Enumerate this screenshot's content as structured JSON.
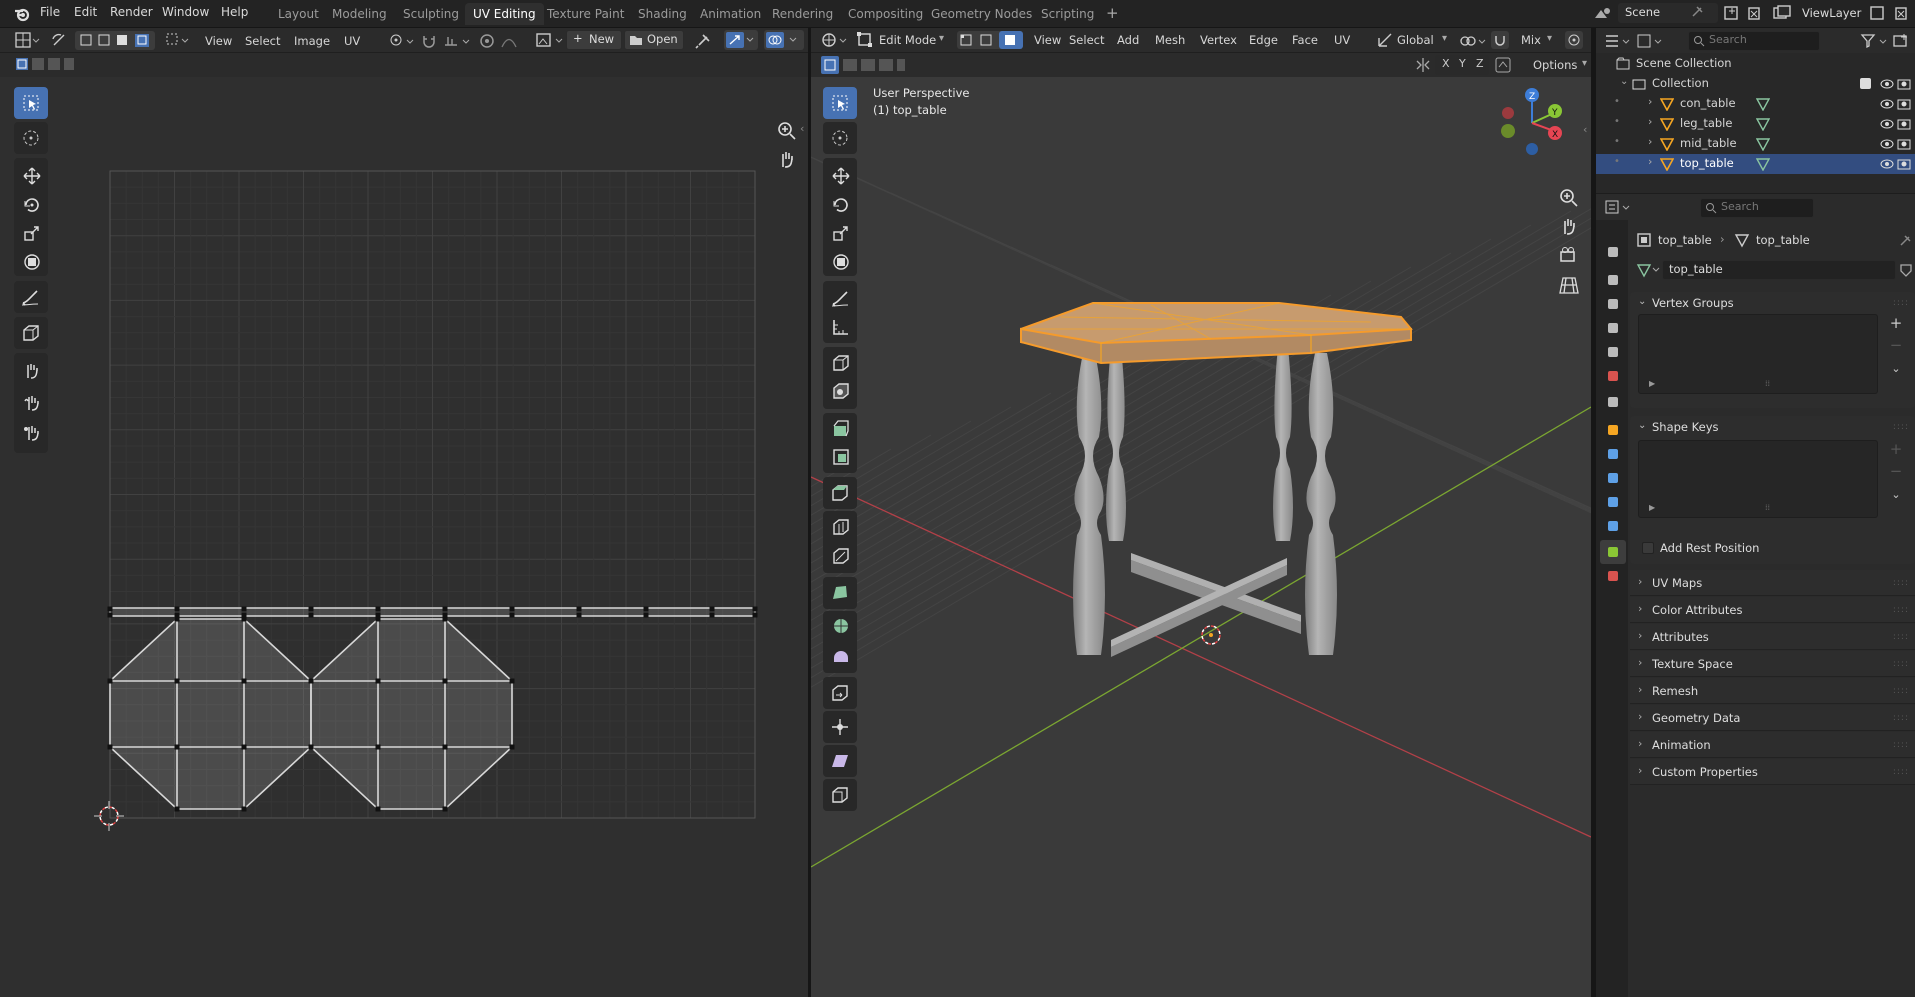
{
  "menu": {
    "file": "File",
    "edit": "Edit",
    "render": "Render",
    "window": "Window",
    "help": "Help"
  },
  "workspaces": [
    "Layout",
    "Modeling",
    "Sculpting",
    "UV Editing",
    "Texture Paint",
    "Shading",
    "Animation",
    "Rendering",
    "Compositing",
    "Geometry Nodes",
    "Scripting"
  ],
  "active_workspace": "UV Editing",
  "scene": {
    "label": "Scene",
    "view_layer": "ViewLayer"
  },
  "uv_header": {
    "view": "View",
    "select": "Select",
    "image": "Image",
    "uv": "UV",
    "new": "New",
    "open": "Open"
  },
  "vp_header": {
    "mode": "Edit Mode",
    "view": "View",
    "select": "Select",
    "add": "Add",
    "mesh": "Mesh",
    "vertex": "Vertex",
    "edge": "Edge",
    "face": "Face",
    "uv": "UV",
    "orientation": "Global",
    "proportional": "Mix",
    "options": "Options",
    "axis_x": "X",
    "axis_y": "Y",
    "axis_z": "Z"
  },
  "viewport": {
    "perspective": "User Perspective",
    "object": "(1) top_table"
  },
  "outliner": {
    "search_placeholder": "Search",
    "scene_collection": "Scene Collection",
    "collection": "Collection",
    "items": [
      "con_table",
      "leg_table",
      "mid_table",
      "top_table"
    ],
    "selected": "top_table"
  },
  "properties": {
    "search_placeholder": "Search",
    "breadcrumb_object": "top_table",
    "breadcrumb_mesh": "top_table",
    "mesh_name": "top_table",
    "vertex_groups": "Vertex Groups",
    "shape_keys": "Shape Keys",
    "add_rest_position": "Add Rest Position",
    "sections": [
      "UV Maps",
      "Color Attributes",
      "Attributes",
      "Texture Space",
      "Remesh",
      "Geometry Data",
      "Animation",
      "Custom Properties"
    ]
  },
  "colors": {
    "accent": "#4772b3",
    "selection_orange": "#f5a623",
    "axis_x": "#e64553",
    "axis_y": "#8ac735",
    "axis_z": "#3d7dd8"
  }
}
